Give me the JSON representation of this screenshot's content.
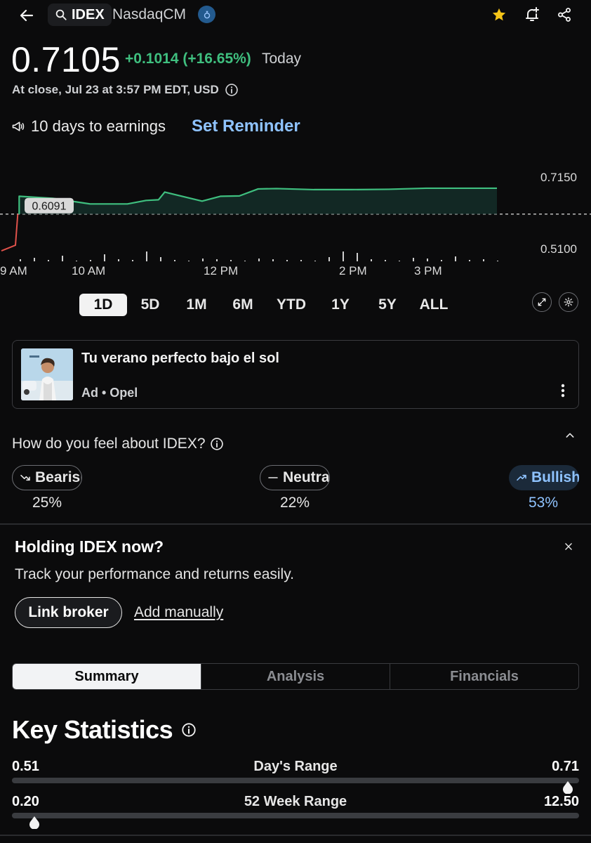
{
  "header": {
    "ticker": "IDEX",
    "exchange": "NasdaqCM"
  },
  "quote": {
    "price": "0.7105",
    "change": "+0.1014 (+16.65%)",
    "period": "Today",
    "close_info": "At close, Jul 23 at 3:57 PM EDT, USD"
  },
  "earnings": {
    "text": "10 days to earnings",
    "reminder_label": "Set Reminder"
  },
  "chart_data": {
    "type": "line",
    "x": [
      "9:30 AM",
      "9:33 AM",
      "10:00 AM",
      "10:30 AM",
      "11:00 AM",
      "11:15 AM",
      "11:25 AM",
      "11:30 AM",
      "12:00 PM",
      "12:15 PM",
      "12:30 PM",
      "12:45 PM",
      "1:00 PM",
      "1:30 PM",
      "2:00 PM",
      "2:30 PM",
      "3:00 PM",
      "3:30 PM",
      "3:57 PM"
    ],
    "y": [
      0.52,
      0.66,
      0.654,
      0.638,
      0.638,
      0.648,
      0.65,
      0.672,
      0.646,
      0.66,
      0.661,
      0.681,
      0.682,
      0.679,
      0.679,
      0.68,
      0.683,
      0.683,
      0.683
    ],
    "previous_close": "0.6091",
    "previous_close_value": 0.6091,
    "x_ticks": [
      "9 AM",
      "10 AM",
      "12 PM",
      "2 PM",
      "3 PM"
    ],
    "y_ticks": [
      "0.7150",
      "0.5100"
    ],
    "ylim": [
      0.51,
      0.715
    ],
    "line_color": "#3fbf7f",
    "pre_color": "#e0524b",
    "volume": [
      3,
      5,
      2,
      8,
      1,
      2,
      10,
      3,
      2,
      14,
      6,
      2,
      1,
      4,
      3,
      2,
      1,
      4,
      3,
      2,
      2,
      1,
      6,
      14,
      12,
      3,
      2,
      1,
      5,
      4,
      2,
      7,
      2,
      3,
      1
    ]
  },
  "ranges": {
    "items": [
      "1D",
      "5D",
      "1M",
      "6M",
      "YTD",
      "1Y",
      "5Y",
      "ALL"
    ],
    "active": "1D"
  },
  "ad": {
    "title": "Tu verano perfecto bajo el sol",
    "sponsor": "Ad • Opel"
  },
  "sentiment": {
    "question": "How do you feel about IDEX?",
    "bearish": {
      "label": "Bearish",
      "pct": "25%"
    },
    "neutral": {
      "label": "Neutral",
      "pct": "22%"
    },
    "bullish": {
      "label": "Bullish",
      "pct": "53%"
    }
  },
  "holding": {
    "title": "Holding IDEX now?",
    "subtitle": "Track your performance and returns easily.",
    "link_broker": "Link broker",
    "add_manually": "Add manually"
  },
  "tabs": {
    "items": [
      "Summary",
      "Analysis",
      "Financials"
    ],
    "active": "Summary"
  },
  "key_stats": {
    "title": "Key Statistics",
    "day_range": {
      "low": "0.51",
      "label": "Day's Range",
      "high": "0.71",
      "position": 0.98
    },
    "week52_range": {
      "low": "0.20",
      "label": "52 Week Range",
      "high": "12.50",
      "position": 0.04
    }
  },
  "colors": {
    "positive": "#3fbf7f",
    "accent": "#8fc3ff",
    "star": "#f5c518"
  }
}
